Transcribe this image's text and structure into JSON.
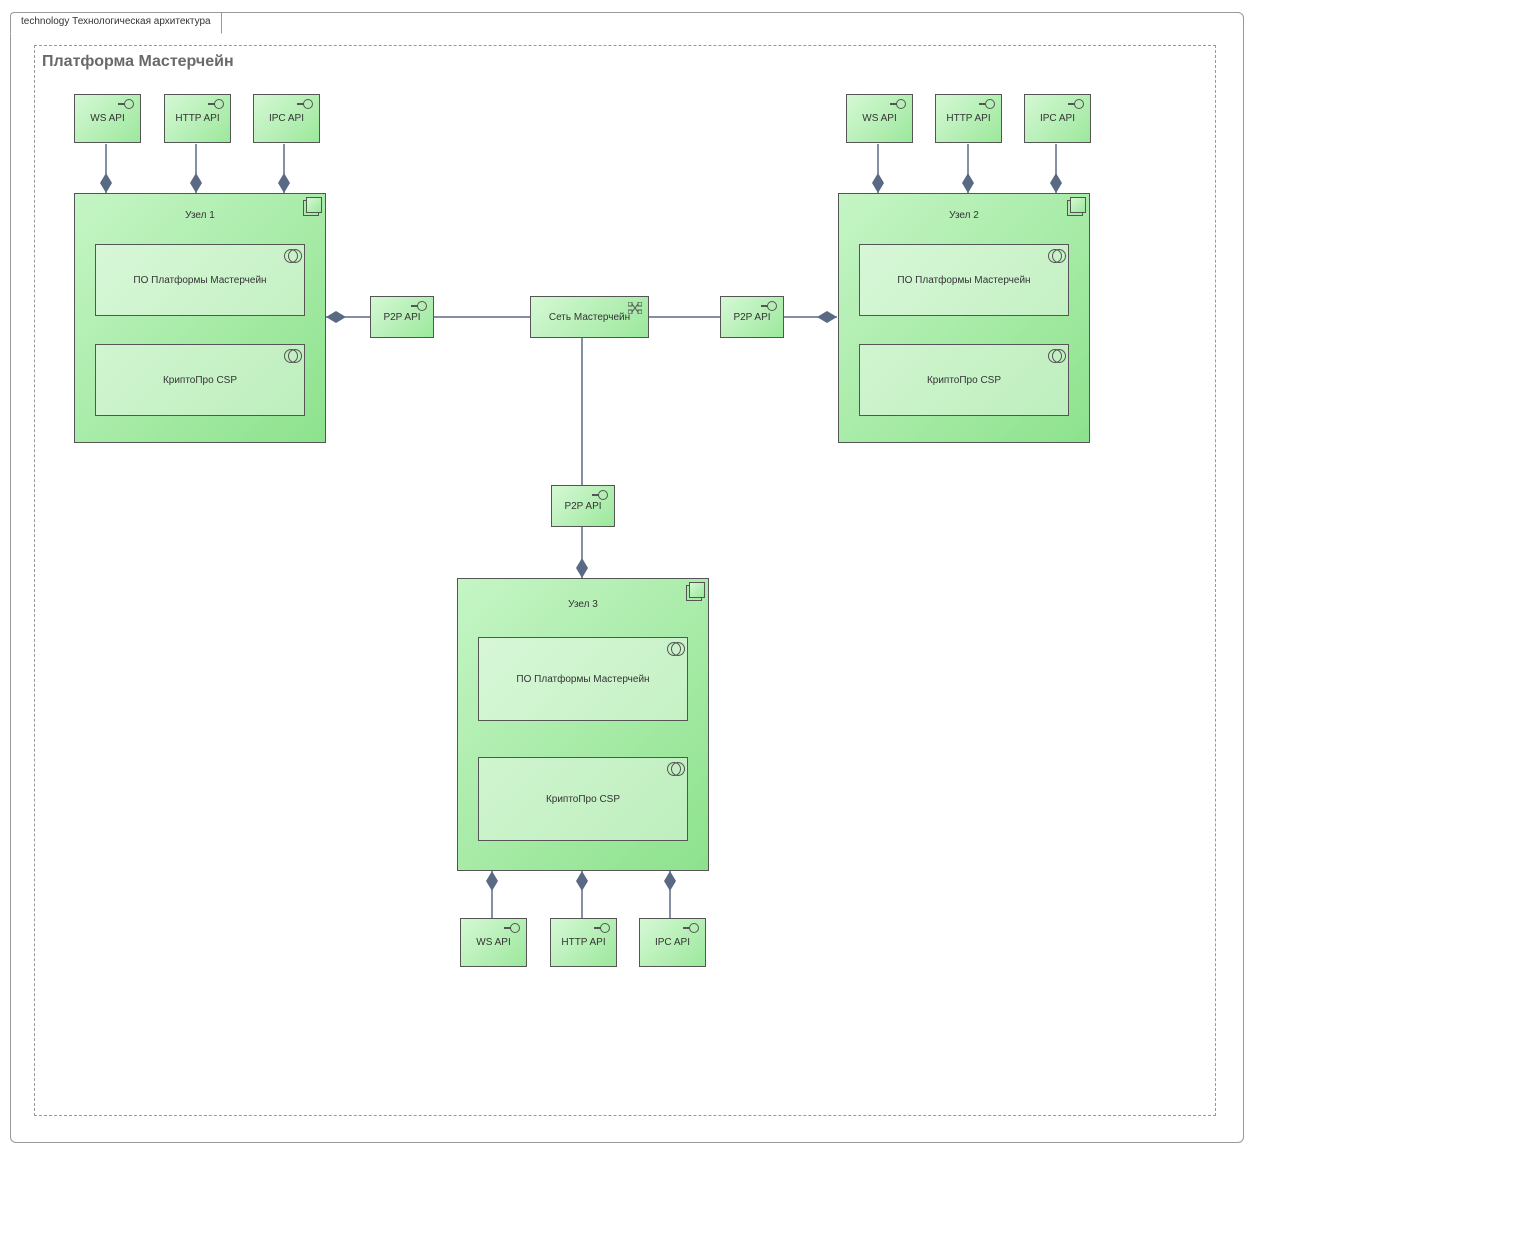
{
  "diagram": {
    "title": "technology Технологическая архитектура",
    "platformTitle": "Платформа Мастерчейн",
    "network": "Сеть Мастерчейн",
    "p2p": "P2P API",
    "apis": {
      "ws": "WS API",
      "http": "HTTP API",
      "ipc": "IPC API"
    },
    "nodes": [
      {
        "name": "Узел 1",
        "soft": "ПО Платформы Мастерчейн",
        "crypto": "КриптоПро CSP"
      },
      {
        "name": "Узел 2",
        "soft": "ПО Платформы Мастерчейн",
        "crypto": "КриптоПро CSP"
      },
      {
        "name": "Узел 3",
        "soft": "ПО Платформы Мастерчейн",
        "crypto": "КриптоПро CSP"
      }
    ]
  }
}
